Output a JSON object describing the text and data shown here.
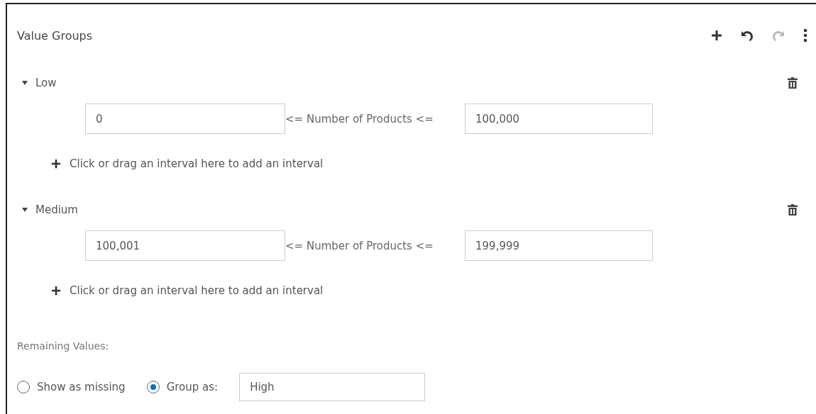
{
  "panel": {
    "title": "Value Groups",
    "toolbar": [
      {
        "kind": "add",
        "disabled": false
      },
      {
        "kind": "undo",
        "disabled": false
      },
      {
        "kind": "redo",
        "disabled": true
      },
      {
        "kind": "more",
        "disabled": false
      }
    ]
  },
  "groups": [
    {
      "name": "Low",
      "expanded": true,
      "intervals": [
        {
          "min": "0",
          "operator": "<= Number of Products <=",
          "max": "100,000"
        }
      ],
      "add_hint": "Click or drag an interval here to add an interval"
    },
    {
      "name": "Medium",
      "expanded": true,
      "intervals": [
        {
          "min": "100,001",
          "operator": "<= Number of Products <=",
          "max": "199,999"
        }
      ],
      "add_hint": "Click or drag an interval here to add an interval"
    }
  ],
  "remaining": {
    "label": "Remaining Values:",
    "options": [
      {
        "label": "Show as missing",
        "selected": false
      },
      {
        "label": "Group as:",
        "selected": true
      }
    ],
    "group_value": "High"
  }
}
